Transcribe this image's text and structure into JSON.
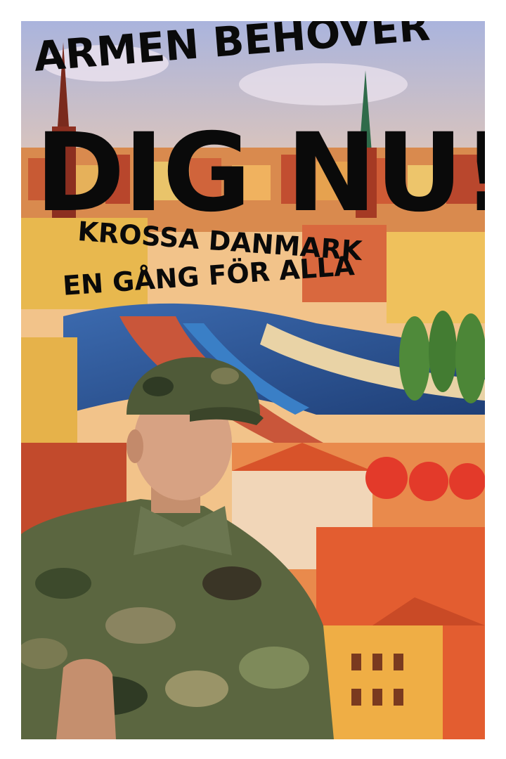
{
  "poster": {
    "headline_top": "ARMEN BEHÖVER",
    "headline_main": "DIG NU!",
    "subline_1": "KROSSA DANMARK",
    "subline_2": "EN GÅNG FÖR ALLA"
  },
  "colors": {
    "text": "#0a0a0a",
    "sky": "#b9a7d6",
    "water": "#2a4f8f",
    "roofs": "#d8532a",
    "camo_green": "#5b6640"
  }
}
